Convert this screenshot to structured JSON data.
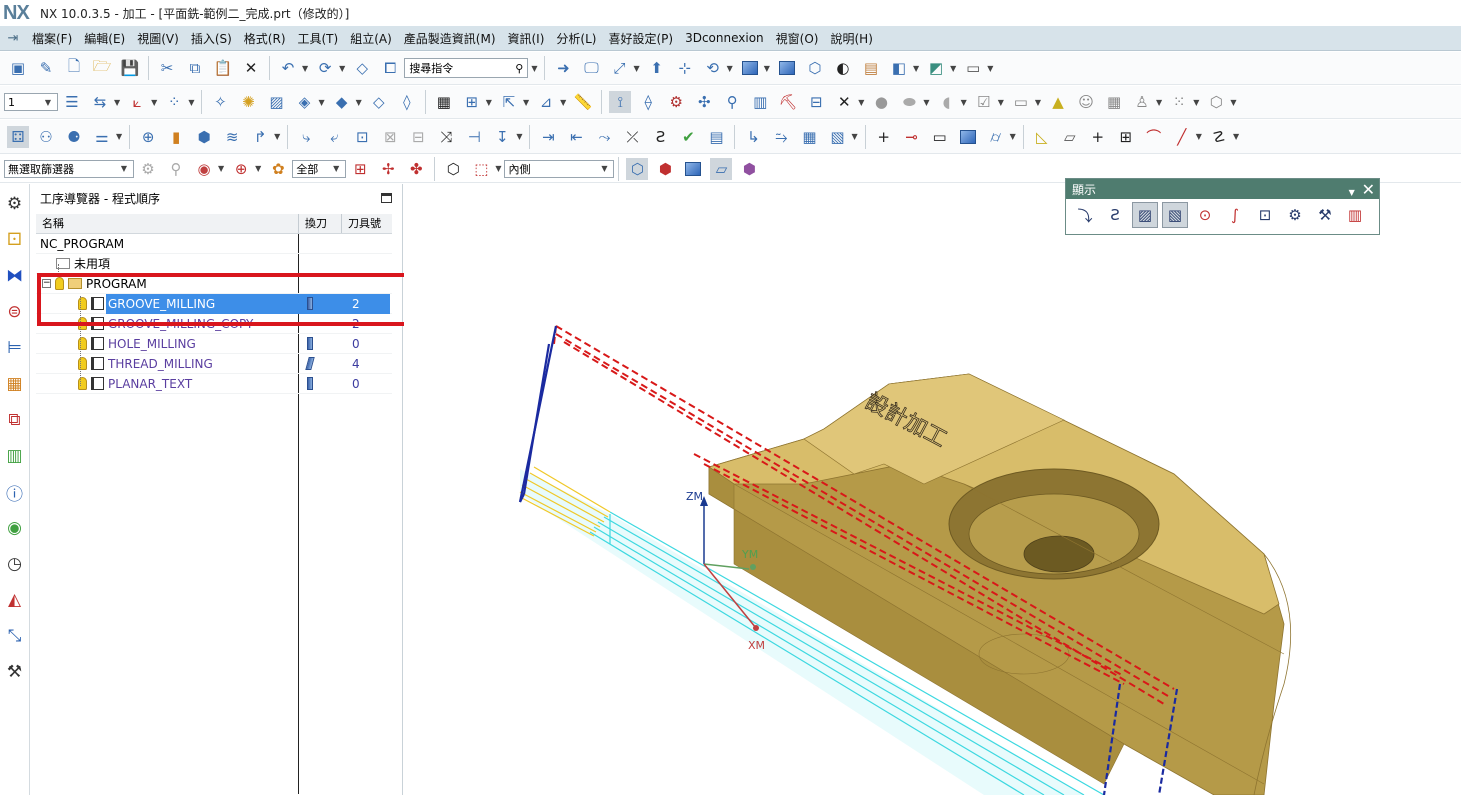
{
  "window": {
    "logo": "NX",
    "title": "NX 10.0.3.5 - 加工 - [平面銑-範例二_完成.prt（修改的）]"
  },
  "menubar": {
    "items": [
      "檔案(F)",
      "編輯(E)",
      "視圖(V)",
      "插入(S)",
      "格式(R)",
      "工具(T)",
      "組立(A)",
      "產品製造資訊(M)",
      "資訊(I)",
      "分析(L)",
      "喜好設定(P)",
      "3Dconnexion",
      "視窗(O)",
      "說明(H)"
    ]
  },
  "toolbar": {
    "search_placeholder": "搜尋指令",
    "layer_value": "1",
    "selection_filter": "無選取篩選器",
    "scope_value": "全部",
    "position_value": "內側"
  },
  "navigator": {
    "title": "工序導覽器 - 程式順序",
    "columns": [
      "名稱",
      "換刀",
      "刀具號"
    ],
    "root": "NC_PROGRAM",
    "unused": "未用項",
    "program": "PROGRAM",
    "operations": [
      {
        "name": "GROOVE_MILLING",
        "tool_no": "2",
        "selected": true
      },
      {
        "name": "GROOVE_MILLING_COPY",
        "tool_no": "2",
        "selected": false
      },
      {
        "name": "HOLE_MILLING",
        "tool_no": "0",
        "selected": false
      },
      {
        "name": "THREAD_MILLING",
        "tool_no": "4",
        "selected": false
      },
      {
        "name": "PLANAR_TEXT",
        "tool_no": "0",
        "selected": false
      }
    ]
  },
  "display_dialog": {
    "title": "顯示"
  },
  "viewport": {
    "axis_z": "ZM",
    "axis_y": "YM",
    "axis_x": "XM",
    "engraved_text": "設計加工"
  },
  "colors": {
    "part": "#d8bd6a",
    "highlight_box": "#d9161d",
    "selection": "#3d8ee8",
    "toolpath_cyan": "#3dd8e0",
    "toolpath_yellow": "#f0c828"
  }
}
